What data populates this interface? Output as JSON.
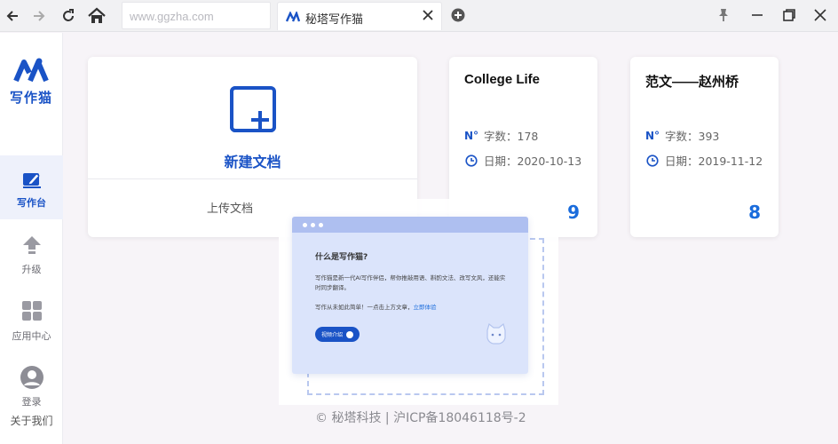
{
  "browser": {
    "url": "www.ggzha.com",
    "tab_title": "秘塔写作猫",
    "accent": "#1a53c6"
  },
  "sidebar": {
    "logo_text": "写作猫",
    "items": [
      {
        "label": "写作台",
        "icon": "edit-icon",
        "active": true
      },
      {
        "label": "升级",
        "icon": "upgrade-arrow-icon",
        "active": false
      },
      {
        "label": "应用中心",
        "icon": "apps-grid-icon",
        "active": false
      },
      {
        "label": "登录",
        "icon": "user-icon",
        "active": false
      }
    ],
    "about": "关于我们"
  },
  "main": {
    "new_doc": {
      "label": "新建文档",
      "upload": "上传文档"
    },
    "docs": [
      {
        "title": "College Life",
        "words_label": "字数：178",
        "date_label": "日期：2020-10-13",
        "count": "9"
      },
      {
        "title": "范文——赵州桥",
        "words_label": "字数：393",
        "date_label": "日期：2019-11-12",
        "count": "8"
      }
    ]
  },
  "tooltip": {
    "title": "什么是写作猫?",
    "body": "写作猫是新一代AI写作伴侣，帮你推敲用语、斟酌文法、改写文风，还能实时同步翻译。",
    "line2_text": "写作从未如此简单！一点击上方文章，",
    "line2_link": "立即体验",
    "button": "视频介绍"
  },
  "footer": "© 秘塔科技 | 沪ICP备18046118号-2"
}
